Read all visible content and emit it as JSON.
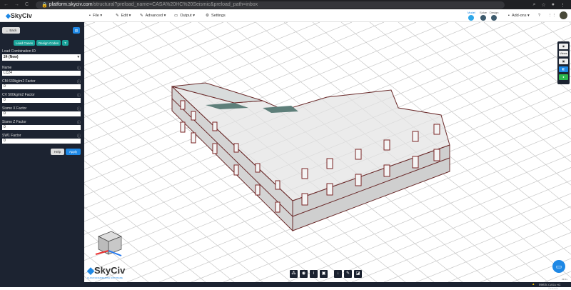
{
  "browser": {
    "url_host": "platform.skyciv.com",
    "url_path": "/structural?preload_name=CASA%20HC%20Seismic&preload_path=inbox"
  },
  "header": {
    "logo": "SkyCiv",
    "menus": [
      "File ▾",
      "Edit ▾",
      "Advanced ▾",
      "Output ▾",
      "Settings"
    ],
    "steps": [
      "Model",
      "Solve",
      "Design"
    ],
    "addons": "Add-ons ▾"
  },
  "sidebar": {
    "back": "Back",
    "tabs": [
      "Load Cases",
      "Design Codes"
    ],
    "filter": "T",
    "combo_label": "Load Combination ID",
    "combo_value": "24 (New)",
    "fields": [
      {
        "label": "Name",
        "value": "LC24"
      },
      {
        "label": "CM 630kg/m2 Factor",
        "value": "0"
      },
      {
        "label": "CV 500kg/m2 Factor",
        "value": "0"
      },
      {
        "label": "Sismo X Factor",
        "value": "0"
      },
      {
        "label": "Sismo Z Factor",
        "value": "0"
      },
      {
        "label": "SW1 Factor",
        "value": "0"
      }
    ],
    "help": "Help",
    "apply": "Apply"
  },
  "right_tools": {
    "views": "Views"
  },
  "watermark": {
    "logo": "SkyCiv",
    "tagline": "CLOUD ENGINEERING SOFTWARE"
  },
  "status": {
    "units": "Metric",
    "project": "CASA HC Seismic",
    "version": "v5.8.x"
  },
  "colors": {
    "accent": "#1aa39a",
    "dark": "#1c2331",
    "blue": "#1e88e5",
    "green": "#2db84d"
  }
}
